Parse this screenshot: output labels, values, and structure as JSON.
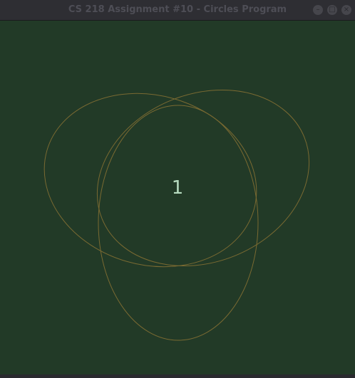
{
  "window": {
    "title": "CS 218 Assignment #10 - Circles Program",
    "controls": {
      "minimize_icon": "minus-icon",
      "maximize_icon": "restore-icon",
      "close_icon": "close-icon"
    }
  },
  "canvas": {
    "background_color": "#223a27",
    "stroke_color": "#7a6a32",
    "count_label": "1"
  }
}
